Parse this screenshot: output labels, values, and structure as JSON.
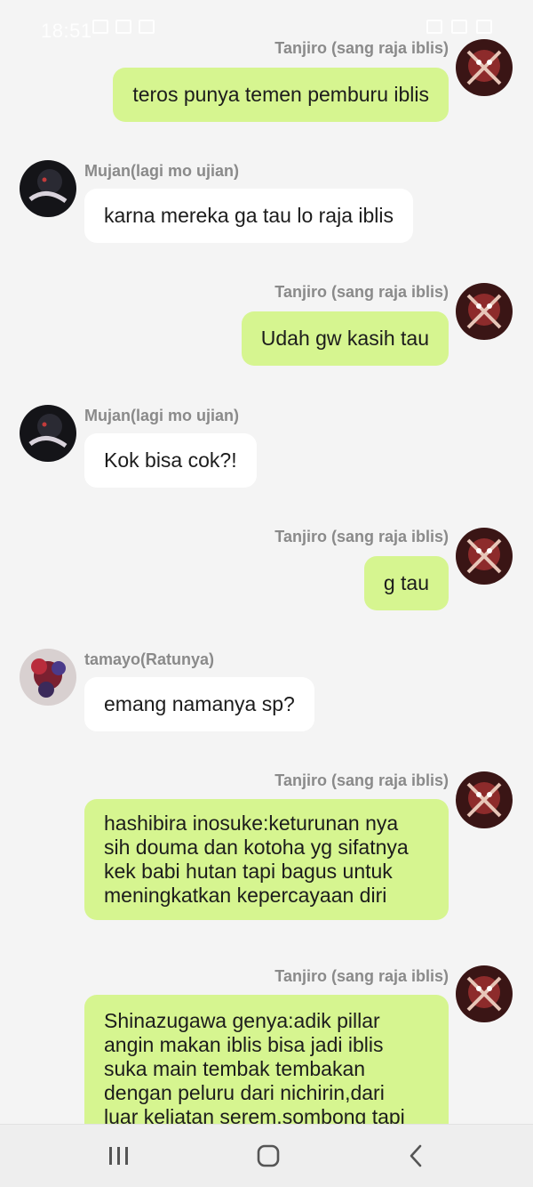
{
  "status_bar": {
    "time": "18:51"
  },
  "colors": {
    "outgoing_bubble": "#d6f590",
    "incoming_bubble": "#ffffff",
    "sender_name": "#8a8a8a",
    "background": "#f4f4f4"
  },
  "messages": [
    {
      "side": "right",
      "sender": "Tanjiro (sang raja iblis)",
      "text": "teros punya temen pemburu iblis"
    },
    {
      "side": "left",
      "sender": "Mujan(lagi mo ujian)",
      "text": "karna mereka ga tau lo raja iblis"
    },
    {
      "side": "right",
      "sender": "Tanjiro (sang raja iblis)",
      "text": "Udah gw kasih tau"
    },
    {
      "side": "left",
      "sender": "Mujan(lagi mo ujian)",
      "text": "Kok bisa cok?!"
    },
    {
      "side": "right",
      "sender": "Tanjiro (sang raja iblis)",
      "text": "g tau"
    },
    {
      "side": "left",
      "sender": "tamayo(Ratunya)",
      "text": "emang namanya sp?"
    },
    {
      "side": "right",
      "sender": "Tanjiro (sang raja iblis)",
      "lines": [
        "hashibira inosuke:keturunan nya",
        "sih douma dan kotoha yg sifatnya",
        "kek babi hutan tapi bagus untuk",
        "meningkatkan kepercayaan diri"
      ]
    },
    {
      "side": "right",
      "sender": "Tanjiro (sang raja iblis)",
      "lines": [
        "Shinazugawa genya:adik pillar",
        "angin makan iblis bisa jadi iblis",
        "suka main tembak tembakan",
        "dengan peluru dari nichirin,dari",
        "luar keliatan serem,sombong tapi"
      ]
    }
  ],
  "nav": {
    "recents_icon": "recents-icon",
    "home_icon": "home-icon",
    "back_icon": "back-icon"
  }
}
